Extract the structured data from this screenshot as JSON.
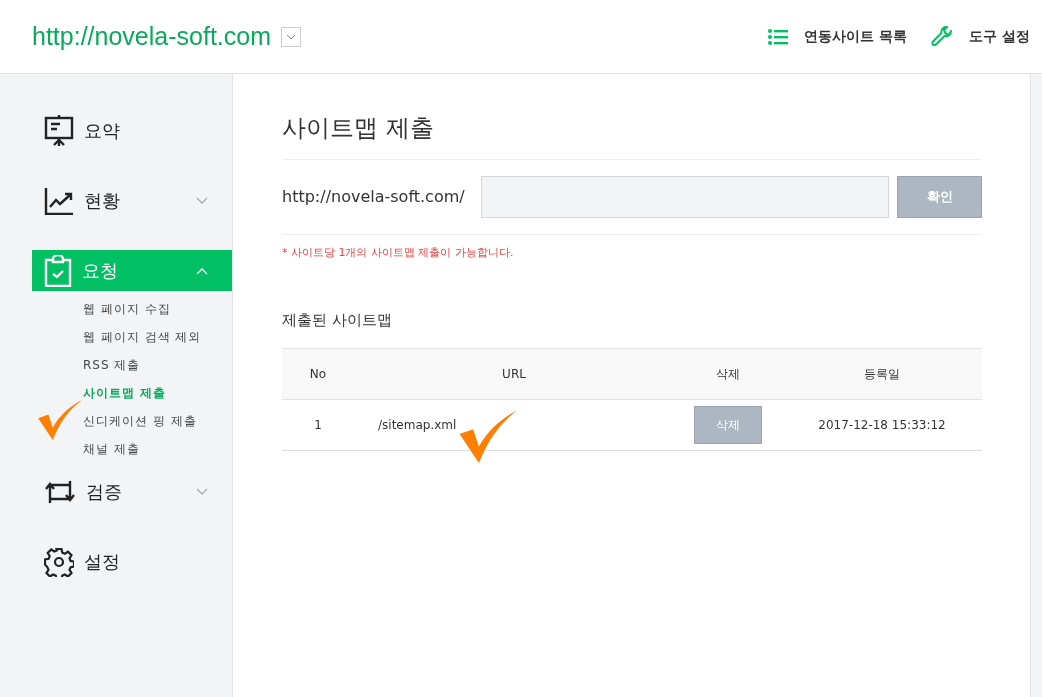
{
  "header": {
    "site": "http://novela-soft.com",
    "links": [
      {
        "label": "연동사이트 목록",
        "kind": "list"
      },
      {
        "label": "도구 설정",
        "kind": "wrench"
      }
    ]
  },
  "sidebar": {
    "items": [
      {
        "label": "요약",
        "kind": "board",
        "selected": false
      },
      {
        "label": "현황",
        "kind": "chart",
        "selected": false,
        "expanded": false
      },
      {
        "label": "요청",
        "kind": "clipboard",
        "selected": true,
        "expanded": true,
        "children": [
          {
            "label": "웹 페이지 수집",
            "selected": false
          },
          {
            "label": "웹 페이지 검색 제외",
            "selected": false
          },
          {
            "label": "RSS 제출",
            "selected": false
          },
          {
            "label": "사이트맵 제출",
            "selected": true
          },
          {
            "label": "신디케이션 핑 제출",
            "selected": false
          },
          {
            "label": "채널 제출",
            "selected": false
          }
        ]
      },
      {
        "label": "검증",
        "kind": "sync",
        "selected": false,
        "expanded": false
      },
      {
        "label": "설정",
        "kind": "gear",
        "selected": false
      }
    ]
  },
  "main": {
    "title": "사이트맵 제출",
    "prefix": "http://novela-soft.com/",
    "confirm_button": "확인",
    "notice": "* 사이트당 1개의 사이트맵 제출이 가능합니다.",
    "list_title": "제출된 사이트맵",
    "table": {
      "columns": [
        "No",
        "URL",
        "삭제",
        "등록일"
      ],
      "rows": [
        {
          "no": "1",
          "url": "/sitemap.xml",
          "delete_button": "삭제",
          "date": "2017-12-18 15:33:12"
        }
      ]
    }
  }
}
